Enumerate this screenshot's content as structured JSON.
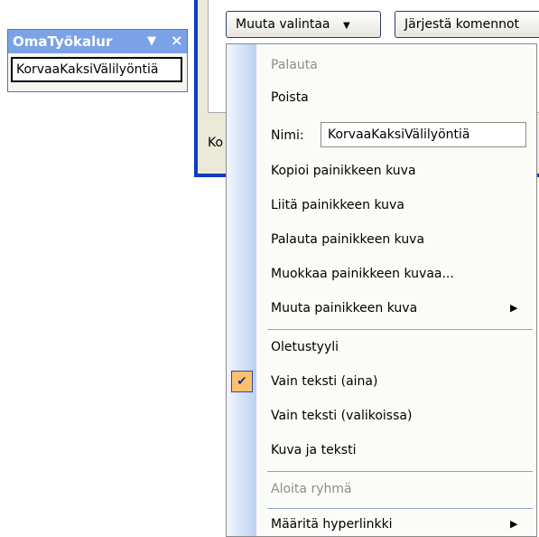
{
  "toolbar": {
    "title": "OmaTyökalur",
    "dropdown_glyph": "▼",
    "close_glyph": "×",
    "button_label": "KorvaaKaksiVälilyöntiä"
  },
  "dialog": {
    "modify_button_label": "Muuta valintaa",
    "modify_button_arrow": "▼",
    "arrange_button_label": "Järjestä komennot",
    "partial_label": "Ko"
  },
  "menu": {
    "items": [
      {
        "label": "Palauta",
        "enabled": false
      },
      {
        "label": "Poista",
        "enabled": true
      },
      {
        "label": "Nimi:",
        "value": "KorvaaKaksiVälilyöntiä"
      },
      {
        "label": "Kopioi painikkeen kuva",
        "enabled": true
      },
      {
        "label": "Liitä painikkeen kuva",
        "enabled": true
      },
      {
        "label": "Palauta painikkeen kuva",
        "enabled": true
      },
      {
        "label": "Muokkaa painikkeen kuvaa...",
        "enabled": true
      },
      {
        "label": "Muuta painikkeen kuva",
        "enabled": true,
        "submenu": true
      },
      {
        "label": "Oletustyyli",
        "enabled": true
      },
      {
        "label": "Vain teksti (aina)",
        "enabled": true,
        "checked": true
      },
      {
        "label": "Vain teksti (valikoissa)",
        "enabled": true
      },
      {
        "label": "Kuva ja teksti",
        "enabled": true
      },
      {
        "label": "Aloita ryhmä",
        "enabled": false
      },
      {
        "label": "Määritä hyperlinkki",
        "enabled": true,
        "submenu": true
      }
    ],
    "check_glyph": "✔",
    "submenu_glyph": "▶"
  },
  "colors": {
    "toolbar_title_bg": "#7ba2e7",
    "dialog_frame": "#0a3fbd",
    "menu_check_bg": "#ffc06e",
    "menu_separator": "#8ca4cf"
  }
}
